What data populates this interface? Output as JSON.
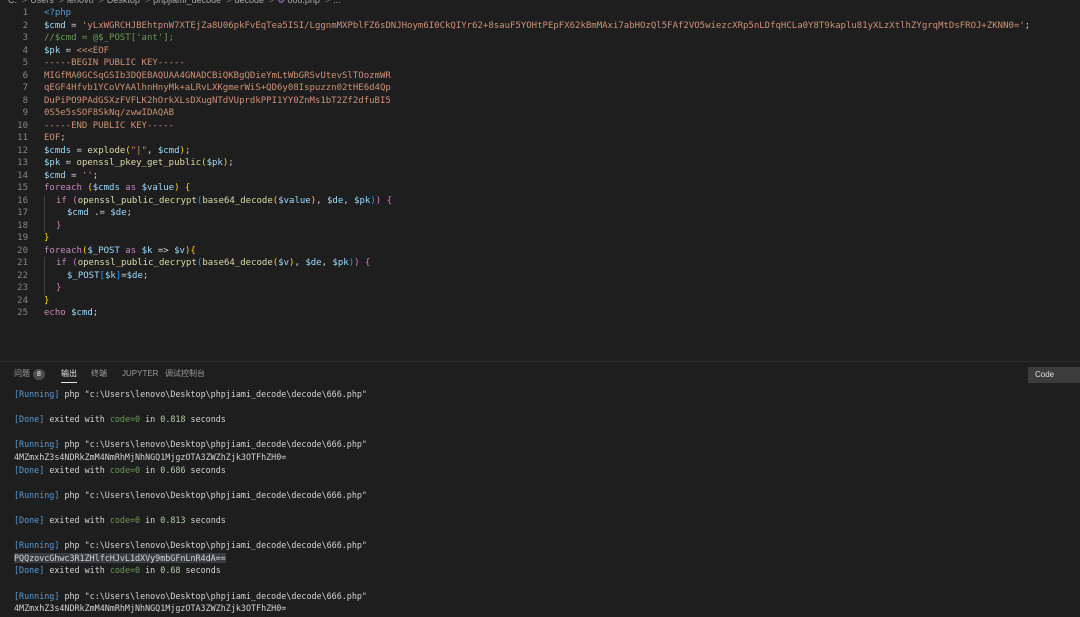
{
  "breadcrumb": {
    "items": [
      "C:",
      "Users",
      "lenovo",
      "Desktop",
      "phpjiami_decode",
      "decode",
      "666.php",
      "..."
    ]
  },
  "editor": {
    "lines": [
      {
        "n": "1",
        "tokens": [
          {
            "t": "<?php",
            "c": "ph"
          }
        ]
      },
      {
        "n": "2",
        "tokens": [
          {
            "t": "$cmd",
            "c": "var"
          },
          {
            "t": " = ",
            "c": "op"
          },
          {
            "t": "'yLxWGRCHJBEhtpnW7XTEjZa8U06pkFvEqTea5ISI/LggnmMXPblFZ6sDNJHoym6I0CkQIYr62+8sauF5YOHtPEpFX62kBmMAxi7abHOzQl5FAf2VO5wiezcXRp5nLDfqHCLa0Y8T9kaplu81yXLzXtlhZYgrqMtDsFROJ+ZKNN0='",
            "c": "str"
          },
          {
            "t": ";",
            "c": "op"
          }
        ]
      },
      {
        "n": "3",
        "tokens": [
          {
            "t": "//$cmd = @$_POST['ant'];",
            "c": "cmt"
          }
        ]
      },
      {
        "n": "4",
        "tokens": [
          {
            "t": "$pk",
            "c": "var"
          },
          {
            "t": " = ",
            "c": "op"
          },
          {
            "t": "<<<EOF",
            "c": "str"
          }
        ]
      },
      {
        "n": "5",
        "tokens": [
          {
            "t": "-----BEGIN PUBLIC KEY-----",
            "c": "str"
          }
        ]
      },
      {
        "n": "6",
        "tokens": [
          {
            "t": "MIGfMA0GCSqGSIb3DQEBAQUAA4GNADCBiQKBgQDieYmLtWbGRSvUtevSlTOozmWR",
            "c": "str"
          }
        ]
      },
      {
        "n": "7",
        "tokens": [
          {
            "t": "qEGF4Hfvb1YCoVYAAlhnHnyMk+aLRvLXKgmerWiS+QD6y08Ispuzzn02tHE6d4Qp",
            "c": "str"
          }
        ]
      },
      {
        "n": "8",
        "tokens": [
          {
            "t": "DuPiPO9PAdGSXzFVFLK2hOrkXLsDXugNTdVUprdkPPI1YY0ZnMs1bT2Zf2dfuBI5",
            "c": "str"
          }
        ]
      },
      {
        "n": "9",
        "tokens": [
          {
            "t": "0S5e5sSOF8SkNq/zwwIDAQAB",
            "c": "str"
          }
        ]
      },
      {
        "n": "10",
        "tokens": [
          {
            "t": "-----END PUBLIC KEY-----",
            "c": "str"
          }
        ]
      },
      {
        "n": "11",
        "tokens": [
          {
            "t": "EOF",
            "c": "str"
          },
          {
            "t": ";",
            "c": "op"
          }
        ]
      },
      {
        "n": "12",
        "tokens": [
          {
            "t": "$cmds",
            "c": "var"
          },
          {
            "t": " = ",
            "c": "op"
          },
          {
            "t": "explode",
            "c": "fn"
          },
          {
            "t": "(",
            "c": "br1"
          },
          {
            "t": "\"|\"",
            "c": "str"
          },
          {
            "t": ", ",
            "c": "op"
          },
          {
            "t": "$cmd",
            "c": "var"
          },
          {
            "t": ")",
            "c": "br1"
          },
          {
            "t": ";",
            "c": "op"
          }
        ]
      },
      {
        "n": "13",
        "tokens": [
          {
            "t": "$pk",
            "c": "var"
          },
          {
            "t": " = ",
            "c": "op"
          },
          {
            "t": "openssl_pkey_get_public",
            "c": "fn"
          },
          {
            "t": "(",
            "c": "br1"
          },
          {
            "t": "$pk",
            "c": "var"
          },
          {
            "t": ")",
            "c": "br1"
          },
          {
            "t": ";",
            "c": "op"
          }
        ]
      },
      {
        "n": "14",
        "tokens": [
          {
            "t": "$cmd",
            "c": "var"
          },
          {
            "t": " = ",
            "c": "op"
          },
          {
            "t": "''",
            "c": "str"
          },
          {
            "t": ";",
            "c": "op"
          }
        ]
      },
      {
        "n": "15",
        "tokens": [
          {
            "t": "foreach",
            "c": "kw"
          },
          {
            "t": " ",
            "c": "op"
          },
          {
            "t": "(",
            "c": "br1"
          },
          {
            "t": "$cmds",
            "c": "var"
          },
          {
            "t": " as ",
            "c": "kw"
          },
          {
            "t": "$value",
            "c": "var"
          },
          {
            "t": ")",
            "c": "br1"
          },
          {
            "t": " ",
            "c": "op"
          },
          {
            "t": "{",
            "c": "br1"
          }
        ]
      },
      {
        "n": "16",
        "indent": 1,
        "tokens": [
          {
            "t": "if",
            "c": "kw"
          },
          {
            "t": " ",
            "c": "op"
          },
          {
            "t": "(",
            "c": "br2"
          },
          {
            "t": "openssl_public_decrypt",
            "c": "fn"
          },
          {
            "t": "(",
            "c": "br3"
          },
          {
            "t": "base64_decode",
            "c": "fn"
          },
          {
            "t": "(",
            "c": "br1"
          },
          {
            "t": "$value",
            "c": "var"
          },
          {
            "t": ")",
            "c": "br1"
          },
          {
            "t": ", ",
            "c": "op"
          },
          {
            "t": "$de",
            "c": "var"
          },
          {
            "t": ", ",
            "c": "op"
          },
          {
            "t": "$pk",
            "c": "var"
          },
          {
            "t": ")",
            "c": "br3"
          },
          {
            "t": ")",
            "c": "br2"
          },
          {
            "t": " ",
            "c": "op"
          },
          {
            "t": "{",
            "c": "br2"
          }
        ]
      },
      {
        "n": "17",
        "indent": 2,
        "tokens": [
          {
            "t": "$cmd",
            "c": "var"
          },
          {
            "t": " .= ",
            "c": "op"
          },
          {
            "t": "$de",
            "c": "var"
          },
          {
            "t": ";",
            "c": "op"
          }
        ]
      },
      {
        "n": "18",
        "indent": 1,
        "tokens": [
          {
            "t": "}",
            "c": "br2"
          }
        ]
      },
      {
        "n": "19",
        "tokens": [
          {
            "t": "}",
            "c": "br1"
          }
        ]
      },
      {
        "n": "20",
        "tokens": [
          {
            "t": "foreach",
            "c": "kw"
          },
          {
            "t": "(",
            "c": "br1"
          },
          {
            "t": "$_POST",
            "c": "var"
          },
          {
            "t": " as ",
            "c": "kw"
          },
          {
            "t": "$k",
            "c": "var"
          },
          {
            "t": " => ",
            "c": "op"
          },
          {
            "t": "$v",
            "c": "var"
          },
          {
            "t": ")",
            "c": "br1"
          },
          {
            "t": "{",
            "c": "br1"
          }
        ]
      },
      {
        "n": "21",
        "indent": 1,
        "tokens": [
          {
            "t": "if",
            "c": "kw"
          },
          {
            "t": " ",
            "c": "op"
          },
          {
            "t": "(",
            "c": "br2"
          },
          {
            "t": "openssl_public_decrypt",
            "c": "fn"
          },
          {
            "t": "(",
            "c": "br3"
          },
          {
            "t": "base64_decode",
            "c": "fn"
          },
          {
            "t": "(",
            "c": "br1"
          },
          {
            "t": "$v",
            "c": "var"
          },
          {
            "t": ")",
            "c": "br1"
          },
          {
            "t": ", ",
            "c": "op"
          },
          {
            "t": "$de",
            "c": "var"
          },
          {
            "t": ", ",
            "c": "op"
          },
          {
            "t": "$pk",
            "c": "var"
          },
          {
            "t": ")",
            "c": "br3"
          },
          {
            "t": ")",
            "c": "br2"
          },
          {
            "t": " ",
            "c": "op"
          },
          {
            "t": "{",
            "c": "br2"
          }
        ]
      },
      {
        "n": "22",
        "indent": 2,
        "tokens": [
          {
            "t": "$_POST",
            "c": "var"
          },
          {
            "t": "[",
            "c": "br3"
          },
          {
            "t": "$k",
            "c": "var"
          },
          {
            "t": "]",
            "c": "br3"
          },
          {
            "t": "=",
            "c": "op"
          },
          {
            "t": "$de",
            "c": "var"
          },
          {
            "t": ";",
            "c": "op"
          }
        ]
      },
      {
        "n": "23",
        "indent": 1,
        "tokens": [
          {
            "t": "}",
            "c": "br2"
          }
        ]
      },
      {
        "n": "24",
        "tokens": [
          {
            "t": "}",
            "c": "br1"
          }
        ]
      },
      {
        "n": "25",
        "tokens": [
          {
            "t": "echo",
            "c": "kw"
          },
          {
            "t": " ",
            "c": "op"
          },
          {
            "t": "$cmd",
            "c": "var"
          },
          {
            "t": ";",
            "c": "op"
          }
        ]
      }
    ]
  },
  "panel": {
    "tabs": [
      {
        "label": "问题",
        "badge": "8",
        "active": false
      },
      {
        "label": "输出",
        "active": true
      },
      {
        "label": "终端",
        "active": false
      },
      {
        "label": "JUPYTER",
        "active": false
      },
      {
        "label": "调试控制台",
        "active": false
      }
    ],
    "channel": "Code"
  },
  "output": {
    "lines": [
      {
        "k": "run",
        "text": "php \"c:\\Users\\lenovo\\Desktop\\phpjiami_decode\\decode\\666.php\""
      },
      {
        "k": "blank"
      },
      {
        "k": "done",
        "text": "0.818"
      },
      {
        "k": "blank"
      },
      {
        "k": "run",
        "text": "php \"c:\\Users\\lenovo\\Desktop\\phpjiami_decode\\decode\\666.php\""
      },
      {
        "k": "plain",
        "text": "4MZmxhZ3s4NDRkZmM4NmRhMjNhNGQ1MjgzOTA3ZWZhZjk3OTFhZH0="
      },
      {
        "k": "done",
        "text": "0.686"
      },
      {
        "k": "blank"
      },
      {
        "k": "run",
        "text": "php \"c:\\Users\\lenovo\\Desktop\\phpjiami_decode\\decode\\666.php\""
      },
      {
        "k": "blank"
      },
      {
        "k": "done",
        "text": "0.813"
      },
      {
        "k": "blank"
      },
      {
        "k": "run",
        "text": "php \"c:\\Users\\lenovo\\Desktop\\phpjiami_decode\\decode\\666.php\""
      },
      {
        "k": "hl",
        "text": "PQQzovcGhwc3R1ZHlfcHJvL1dXVy9mbGFnLnR4dA=="
      },
      {
        "k": "done",
        "text": "0.68"
      },
      {
        "k": "blank"
      },
      {
        "k": "run",
        "text": "php \"c:\\Users\\lenovo\\Desktop\\phpjiami_decode\\decode\\666.php\""
      },
      {
        "k": "plain",
        "text": "4MZmxhZ3s4NDRkZmM4NmRhMjNhNGQ1MjgzOTA3ZWZhZjk3OTFhZH0="
      }
    ],
    "running_label": "[Running]",
    "done_label": "[Done]",
    "exited_text": "exited with",
    "code_label": "code=0",
    "in_text": "in",
    "seconds_text": "seconds"
  }
}
